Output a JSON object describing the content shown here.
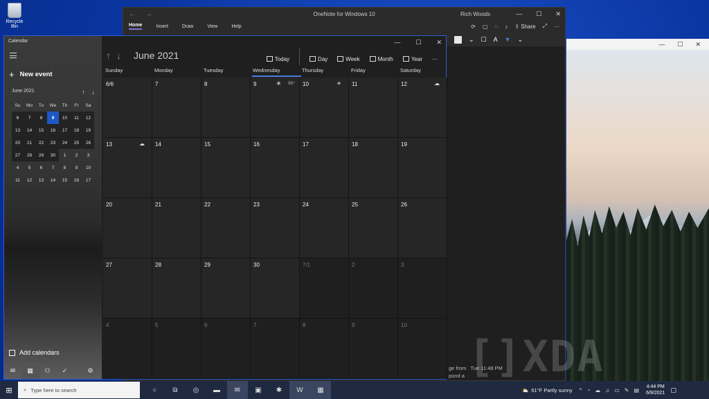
{
  "desktop": {
    "recycle_bin_label": "Recycle Bin"
  },
  "photo_window": {
    "minimize": "—",
    "maximize": "☐",
    "close": "✕"
  },
  "onenote": {
    "title": "OneNote for Windows 10",
    "user": "Rich Woods",
    "back": "←",
    "forward": "→",
    "minimize": "—",
    "maximize": "☐",
    "close": "✕",
    "tabs": [
      "Home",
      "Insert",
      "Draw",
      "View",
      "Help"
    ],
    "share_label": "Share",
    "notification_line1": "ge from",
    "notification_time": "Tue 11:48 PM",
    "notification_line2": "pond a"
  },
  "calendar": {
    "app_title": "Calendar",
    "new_event_label": "New event",
    "mini_month": "June 2021",
    "mini_days": [
      "Su",
      "Mo",
      "Tu",
      "We",
      "Th",
      "Fr",
      "Sa"
    ],
    "mini_weeks": [
      [
        "6",
        "7",
        "8",
        "9",
        "10",
        "11",
        "12"
      ],
      [
        "13",
        "14",
        "15",
        "16",
        "17",
        "18",
        "19"
      ],
      [
        "20",
        "21",
        "22",
        "23",
        "24",
        "25",
        "26"
      ],
      [
        "27",
        "28",
        "29",
        "30",
        "1",
        "2",
        "3"
      ],
      [
        "4",
        "5",
        "6",
        "7",
        "8",
        "9",
        "10"
      ],
      [
        "11",
        "12",
        "13",
        "14",
        "15",
        "16",
        "17"
      ]
    ],
    "add_calendars_label": "Add calendars",
    "month_label": "June 2021",
    "views": {
      "today": "Today",
      "day": "Day",
      "week": "Week",
      "month": "Month",
      "year": "Year",
      "more": "···"
    },
    "weekdays": [
      "Sunday",
      "Monday",
      "Tuesday",
      "Wednesday",
      "Thursday",
      "Friday",
      "Saturday"
    ],
    "weeks": [
      [
        "6/6",
        "7",
        "8",
        "9",
        "10",
        "11",
        "12"
      ],
      [
        "13",
        "14",
        "15",
        "16",
        "17",
        "18",
        "19"
      ],
      [
        "20",
        "21",
        "22",
        "23",
        "24",
        "25",
        "26"
      ],
      [
        "27",
        "28",
        "29",
        "30",
        "7/1",
        "2",
        "3"
      ],
      [
        "4",
        "5",
        "6",
        "7",
        "8",
        "9",
        "10"
      ]
    ],
    "wednesday_temp": "90°",
    "accent": "#1f57c7"
  },
  "taskbar": {
    "search_placeholder": "Type here to search",
    "weather": "61°F  Partly sunny",
    "time": "4:44 PM",
    "date": "6/9/2021"
  }
}
